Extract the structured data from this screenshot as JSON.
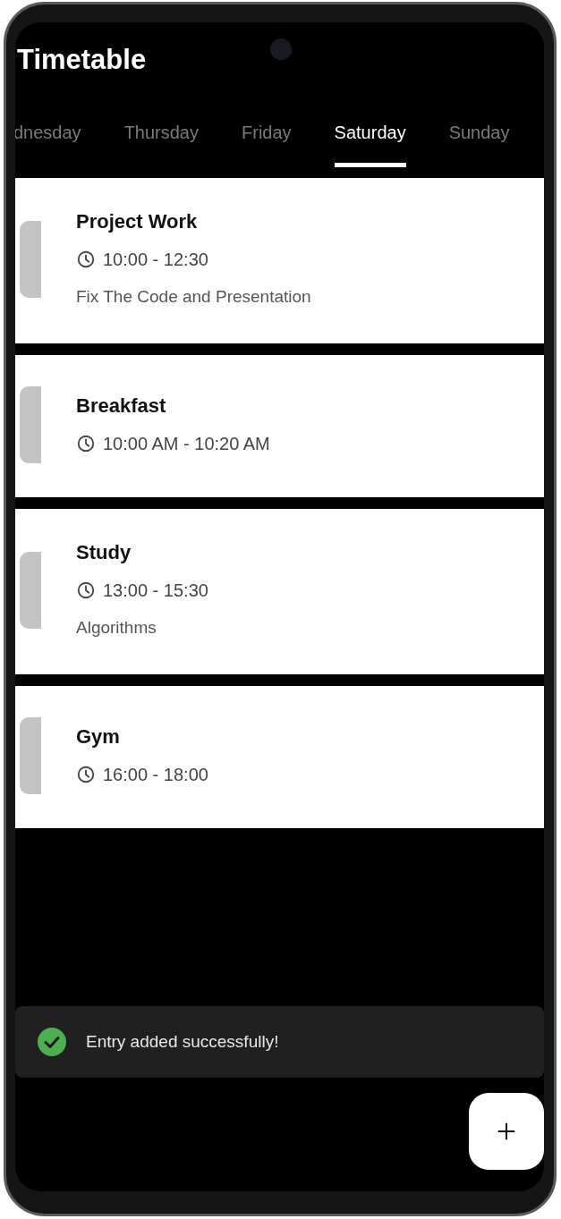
{
  "app_bar": {
    "title": "Timetable"
  },
  "tabs": [
    {
      "label": "dnesday",
      "selected": false
    },
    {
      "label": "Thursday",
      "selected": false
    },
    {
      "label": "Friday",
      "selected": false
    },
    {
      "label": "Saturday",
      "selected": true
    },
    {
      "label": "Sunday",
      "selected": false
    }
  ],
  "entries": [
    {
      "title": "Project Work",
      "time": "10:00 - 12:30",
      "description": "Fix The Code and Presentation"
    },
    {
      "title": "Breakfast",
      "time": "10:00 AM - 10:20 AM"
    },
    {
      "title": "Study",
      "time": "13:00 - 15:30",
      "description": "Algorithms"
    },
    {
      "title": "Gym",
      "time": "16:00 - 18:00"
    }
  ],
  "snackbar": {
    "message": "Entry added successfully!"
  }
}
